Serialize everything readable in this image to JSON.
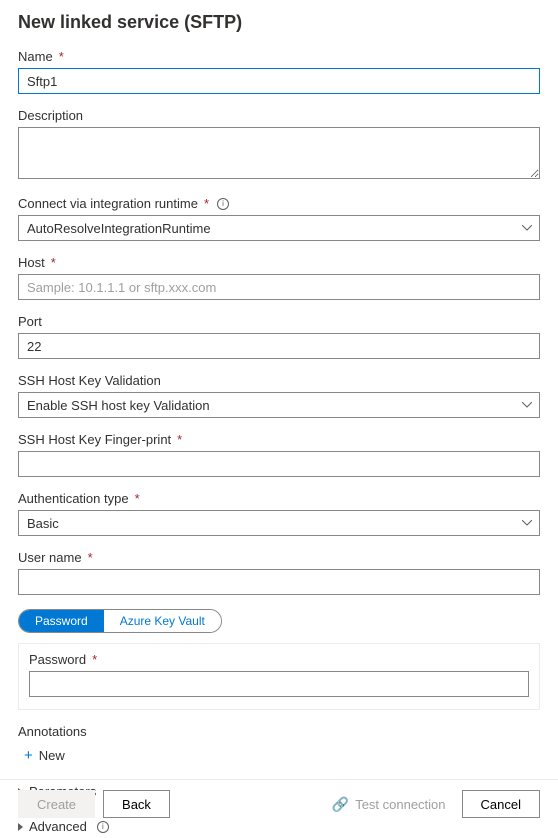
{
  "title": "New linked service (SFTP)",
  "name": {
    "label": "Name",
    "value": "Sftp1"
  },
  "description": {
    "label": "Description",
    "value": ""
  },
  "runtime": {
    "label": "Connect via integration runtime",
    "value": "AutoResolveIntegrationRuntime"
  },
  "host": {
    "label": "Host",
    "placeholder": "Sample: 10.1.1.1 or sftp.xxx.com",
    "value": ""
  },
  "port": {
    "label": "Port",
    "value": "22"
  },
  "sshValidation": {
    "label": "SSH Host Key Validation",
    "value": "Enable SSH host key Validation"
  },
  "sshFingerprint": {
    "label": "SSH Host Key Finger-print",
    "value": ""
  },
  "authType": {
    "label": "Authentication type",
    "value": "Basic"
  },
  "userName": {
    "label": "User name",
    "value": ""
  },
  "credentialTabs": {
    "password": "Password",
    "akv": "Azure Key Vault"
  },
  "password": {
    "label": "Password",
    "value": ""
  },
  "annotations": {
    "label": "Annotations",
    "addNew": "New"
  },
  "sections": {
    "parameters": "Parameters",
    "advanced": "Advanced"
  },
  "footer": {
    "create": "Create",
    "back": "Back",
    "test": "Test connection",
    "cancel": "Cancel"
  }
}
